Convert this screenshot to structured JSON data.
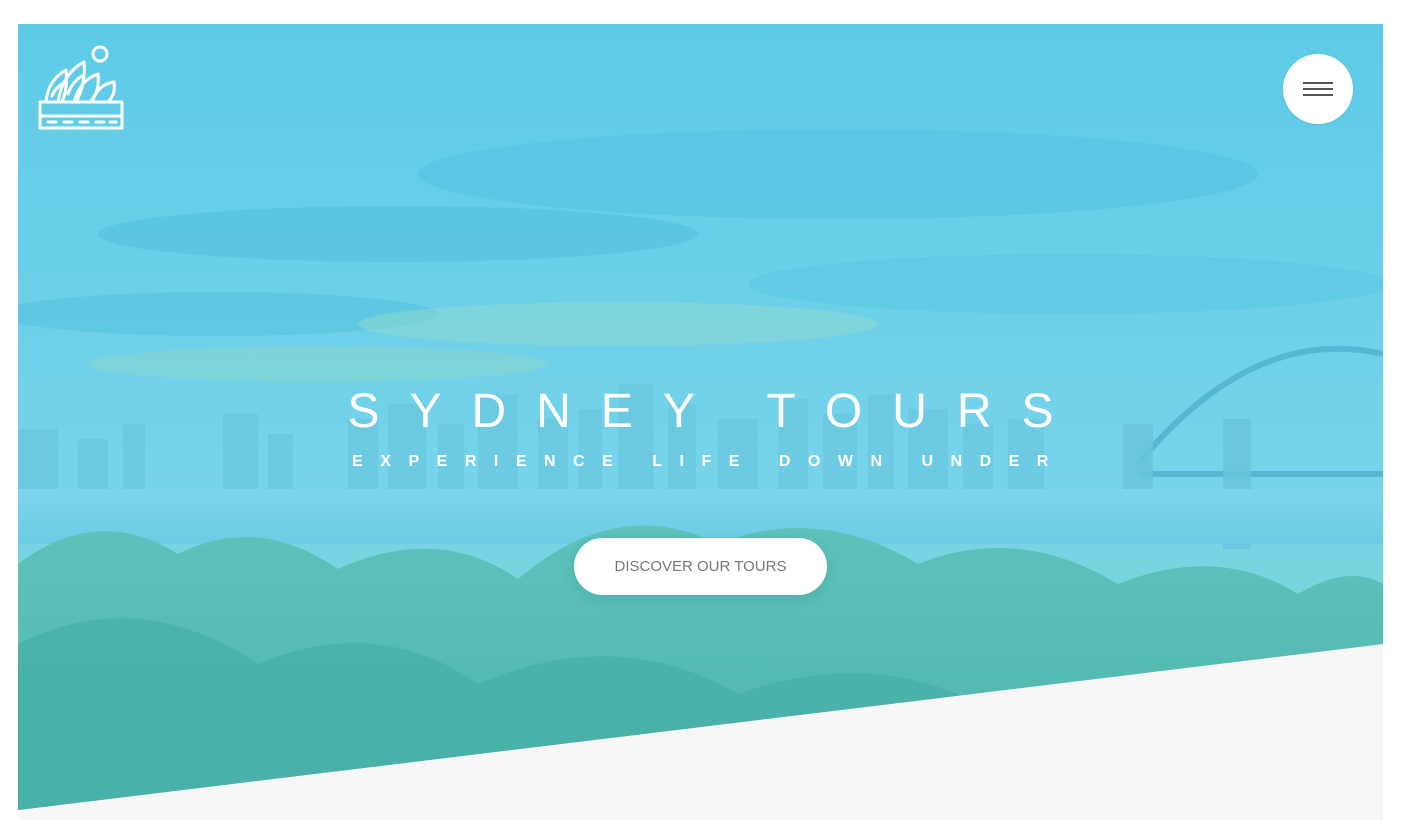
{
  "logo": {
    "icon": "opera-house-icon"
  },
  "nav": {
    "menu_icon": "hamburger-menu-icon"
  },
  "hero": {
    "title": "SYDNEY TOURS",
    "subtitle": "EXPERIENCE LIFE DOWN UNDER",
    "cta_label": "DISCOVER OUR TOURS"
  },
  "colors": {
    "overlay": "#5ecde8",
    "section_bg": "#f7f7f7",
    "button_bg": "#ffffff",
    "button_text": "#777777"
  }
}
